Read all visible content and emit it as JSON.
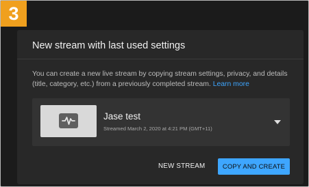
{
  "step": {
    "number": "3",
    "color": "#f0a01e"
  },
  "dialog": {
    "title": "New stream with last used settings",
    "description": "You can create a new live stream by copying stream settings, privacy, and details (title, category, etc.) from a previously completed stream.",
    "learn_more": "Learn more"
  },
  "stream": {
    "title": "Jase test",
    "meta": "Streamed March 2, 2020 at 4:21 PM (GMT+11)",
    "thumbnail_icon": "waveform-icon",
    "dropdown_icon": "chevron-down-icon"
  },
  "actions": {
    "new_stream": "NEW STREAM",
    "copy_and_create": "COPY AND CREATE"
  },
  "colors": {
    "accent": "#3ea6ff",
    "dialog_bg": "#282828",
    "card_bg": "#333333"
  }
}
